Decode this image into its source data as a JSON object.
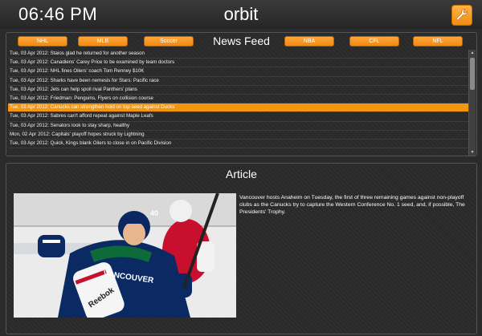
{
  "header": {
    "time": "06:46 PM",
    "app_title": "orbit",
    "settings_icon": "wrench-icon",
    "accent_color": "#f4950f"
  },
  "feed": {
    "title": "News Feed",
    "categories_left": [
      "NHL",
      "MLB",
      "Soccer"
    ],
    "categories_right": [
      "NBA",
      "CFL",
      "NFL"
    ],
    "selected_index": 6,
    "items": [
      "Tue, 03 Apr 2012: Staios glad he returned for another season",
      "Tue, 03 Apr 2012: Canadiens' Carey Price to be examined by team doctors",
      "Tue, 03 Apr 2012: NHL fines Oilers' coach Tom Renney $10K",
      "Tue, 03 Apr 2012: Sharks have been nemesis for Stars: Pacific race",
      "Tue, 03 Apr 2012: Jets can help spoil rival Panthers' plans",
      "Tue, 03 Apr 2012: Friedman: Penguins, Flyers on collision course",
      "Tue, 03 Apr 2012: Canucks can strengthen hold on top seed against Ducks",
      "Tue, 03 Apr 2012: Sabres can't afford repeat against Maple Leafs",
      "Tue, 03 Apr 2012: Senators look to stay sharp, healthy",
      "Mon, 02 Apr 2012: Capitals' playoff hopes struck by Lightning",
      "Tue, 03 Apr 2012: Quick, Kings blank Oilers to close in on Pacific Division"
    ]
  },
  "article": {
    "title": "Article",
    "body": "Vancouver hosts Anaheim on Tuesday, the first of three remaining games against non-playoff clubs as the Canucks try to capture the Western Conference No. 1 seed, and, if possible, The Presidents' Trophy.",
    "image_text": {
      "jersey_brand": "VANCOUVER",
      "number": "40",
      "glove_brand": "Reebok"
    }
  }
}
